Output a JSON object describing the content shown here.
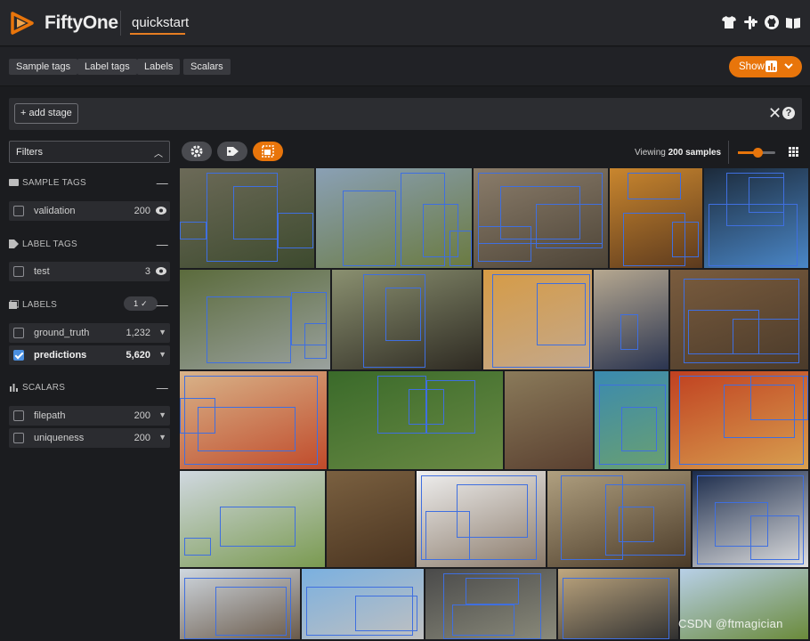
{
  "app": {
    "brand": "FiftyOne",
    "dataset": "quickstart"
  },
  "header_icons": [
    "tshirt-icon",
    "slack-icon",
    "github-icon",
    "book-icon"
  ],
  "tabs": [
    "Sample tags",
    "Label tags",
    "Labels",
    "Scalars"
  ],
  "show_button": {
    "label": "Show"
  },
  "stage_bar": {
    "add_stage_label": "+ add stage",
    "help_label": "?"
  },
  "sidebar": {
    "filters_label": "Filters",
    "sections": {
      "sample_tags": {
        "title": "SAMPLE TAGS",
        "rows": [
          {
            "label": "validation",
            "count": "200"
          }
        ]
      },
      "label_tags": {
        "title": "LABEL TAGS",
        "rows": [
          {
            "label": "test",
            "count": "3"
          }
        ]
      },
      "labels": {
        "title": "LABELS",
        "pill": "1 ✓",
        "rows": [
          {
            "label": "ground_truth",
            "count": "1,232",
            "checked": false
          },
          {
            "label": "predictions",
            "count": "5,620",
            "checked": true
          }
        ]
      },
      "scalars": {
        "title": "SCALARS",
        "rows": [
          {
            "label": "filepath",
            "count": "200"
          },
          {
            "label": "uniqueness",
            "count": "200"
          }
        ]
      }
    }
  },
  "grid_toolbar": {
    "viewing_prefix": "Viewing",
    "viewing_count": "200 samples"
  },
  "colors": {
    "accent": "#e8750b",
    "box": "#3f6fe0",
    "checkbox": "#4a8fe0"
  },
  "watermark": "CSDN @ftmagician"
}
